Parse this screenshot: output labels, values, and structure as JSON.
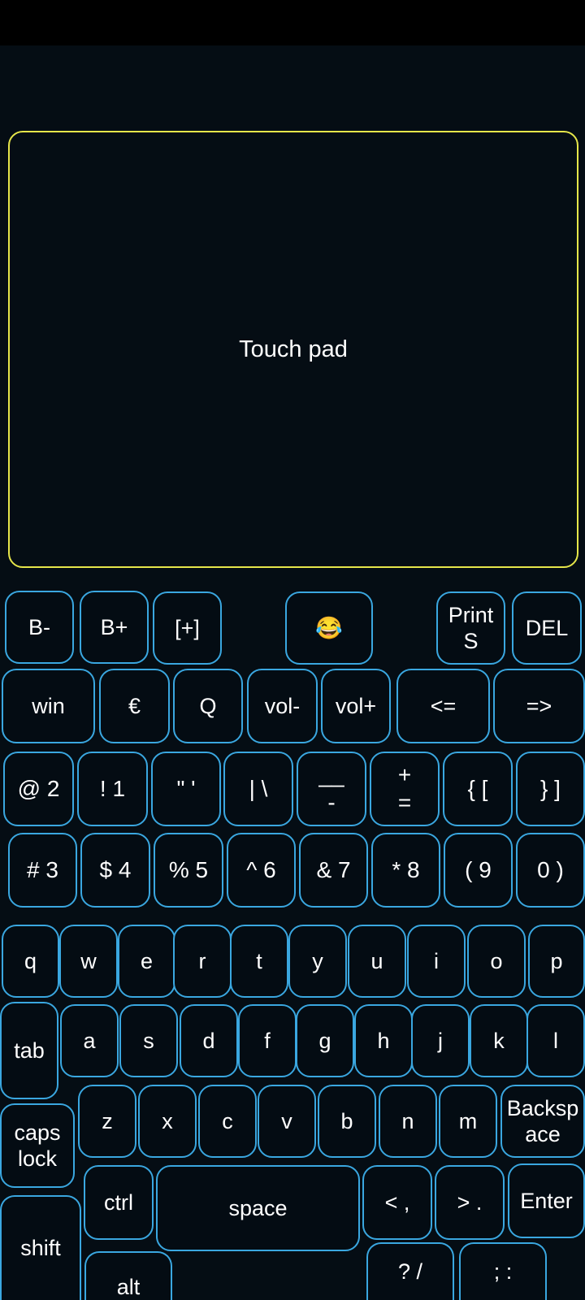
{
  "touchpad": {
    "label": "Touch pad"
  },
  "keys": {
    "b_minus": "B-",
    "b_plus": "B+",
    "plus_box": "[+]",
    "emoji": "😂",
    "print": "Print\nS",
    "del": "DEL",
    "win": "win",
    "euro": "€",
    "q_upper": "Q",
    "vol_minus": "vol-",
    "vol_plus": "vol+",
    "left_arrow": "<=",
    "right_arrow": "=>",
    "at2": "@ 2",
    "ex1": "! 1",
    "quotes": "\" '",
    "pipe": "| \\",
    "underscore": "__\n-",
    "plus_eq": "+\n=",
    "brace_l": "{ [",
    "brace_r": "} ]",
    "hash3": "# 3",
    "dollar4": "$ 4",
    "pct5": "% 5",
    "caret6": "^ 6",
    "amp7": "& 7",
    "star8": "* 8",
    "paren9": "( 9",
    "paren0": "0 )",
    "q": "q",
    "w": "w",
    "e": "e",
    "r": "r",
    "t": "t",
    "y": "y",
    "u": "u",
    "i": "i",
    "o": "o",
    "p": "p",
    "tab": "tab",
    "a": "a",
    "s": "s",
    "d": "d",
    "f": "f",
    "g": "g",
    "h": "h",
    "j": "j",
    "k": "k",
    "l": "l",
    "caps": "caps\nlock",
    "z": "z",
    "x": "x",
    "c": "c",
    "v": "v",
    "b": "b",
    "n": "n",
    "m": "m",
    "backspace": "Backsp\nace",
    "shift": "shift",
    "ctrl": "ctrl",
    "space": "space",
    "lt": "< ,",
    "gt": "> .",
    "enter": "Enter",
    "alt": "alt",
    "question": "? /",
    "colon": "; :"
  }
}
